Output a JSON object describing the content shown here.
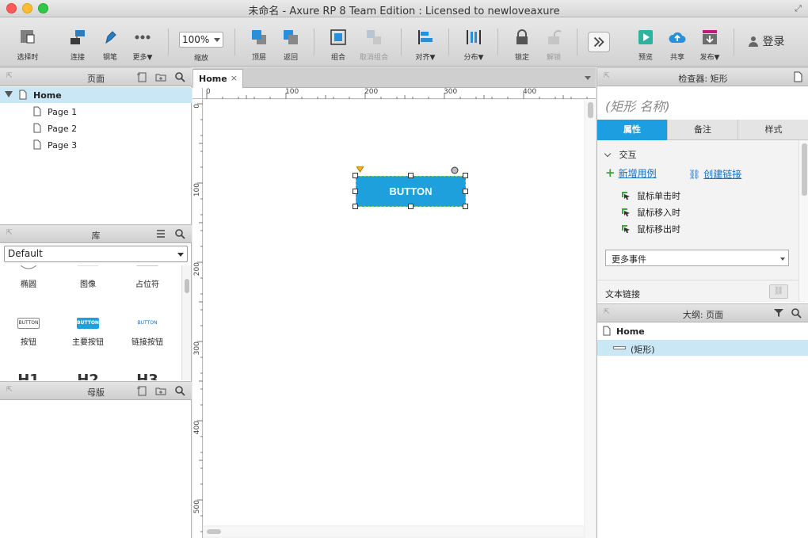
{
  "window": {
    "title": "未命名 - Axure RP 8 Team Edition : Licensed to newloveaxure"
  },
  "toolbar": {
    "select": "选择时",
    "connect": "连接",
    "pen": "钢笔",
    "more": "更多▼",
    "zoom_value": "100%",
    "zoom_label": "缩放",
    "top": "顶层",
    "back": "返回",
    "group": "组合",
    "ungroup": "取消组合",
    "align": "对齐▼",
    "distribute": "分布▼",
    "lock": "锁定",
    "unlock": "解锁",
    "preview": "预览",
    "share": "共享",
    "publish": "发布▼",
    "login": "登录"
  },
  "pages_panel": {
    "title": "页面",
    "items": [
      {
        "label": "Home"
      },
      {
        "label": "Page 1"
      },
      {
        "label": "Page 2"
      },
      {
        "label": "Page 3"
      }
    ]
  },
  "library_panel": {
    "title": "库",
    "selected": "Default",
    "items": [
      {
        "label": "椭圆"
      },
      {
        "label": "图像"
      },
      {
        "label": "占位符"
      },
      {
        "label": "按钮",
        "preview": "BUTTON"
      },
      {
        "label": "主要按钮",
        "preview": "BUTTON"
      },
      {
        "label": "链接按钮",
        "preview": "BUTTON"
      },
      {
        "label": "H1"
      },
      {
        "label": "H2"
      },
      {
        "label": "H3"
      }
    ]
  },
  "masters_panel": {
    "title": "母版"
  },
  "canvas": {
    "tab": "Home",
    "tab_close": "×",
    "ruler_h": [
      "0",
      "100",
      "200",
      "300",
      "400"
    ],
    "ruler_v": [
      "0",
      "100",
      "200",
      "300",
      "400",
      "500"
    ],
    "widget_label": "BUTTON"
  },
  "inspector": {
    "title": "检查器: 矩形",
    "shape_name_placeholder": "(矩形 名称)",
    "tabs": [
      "属性",
      "备注",
      "样式"
    ],
    "section": "交互",
    "add_case": "新增用例",
    "create_link": "创建链接",
    "events": [
      "鼠标单击时",
      "鼠标移入时",
      "鼠标移出时"
    ],
    "more_events": "更多事件",
    "text_link": "文本链接"
  },
  "outline": {
    "title": "大纲: 页面",
    "items": [
      {
        "label": "Home"
      },
      {
        "label": "(矩形)"
      }
    ]
  },
  "colors": {
    "accent": "#1d9ee0",
    "selection": "#c9e7f5",
    "button_fill": "#1ea0dc"
  }
}
